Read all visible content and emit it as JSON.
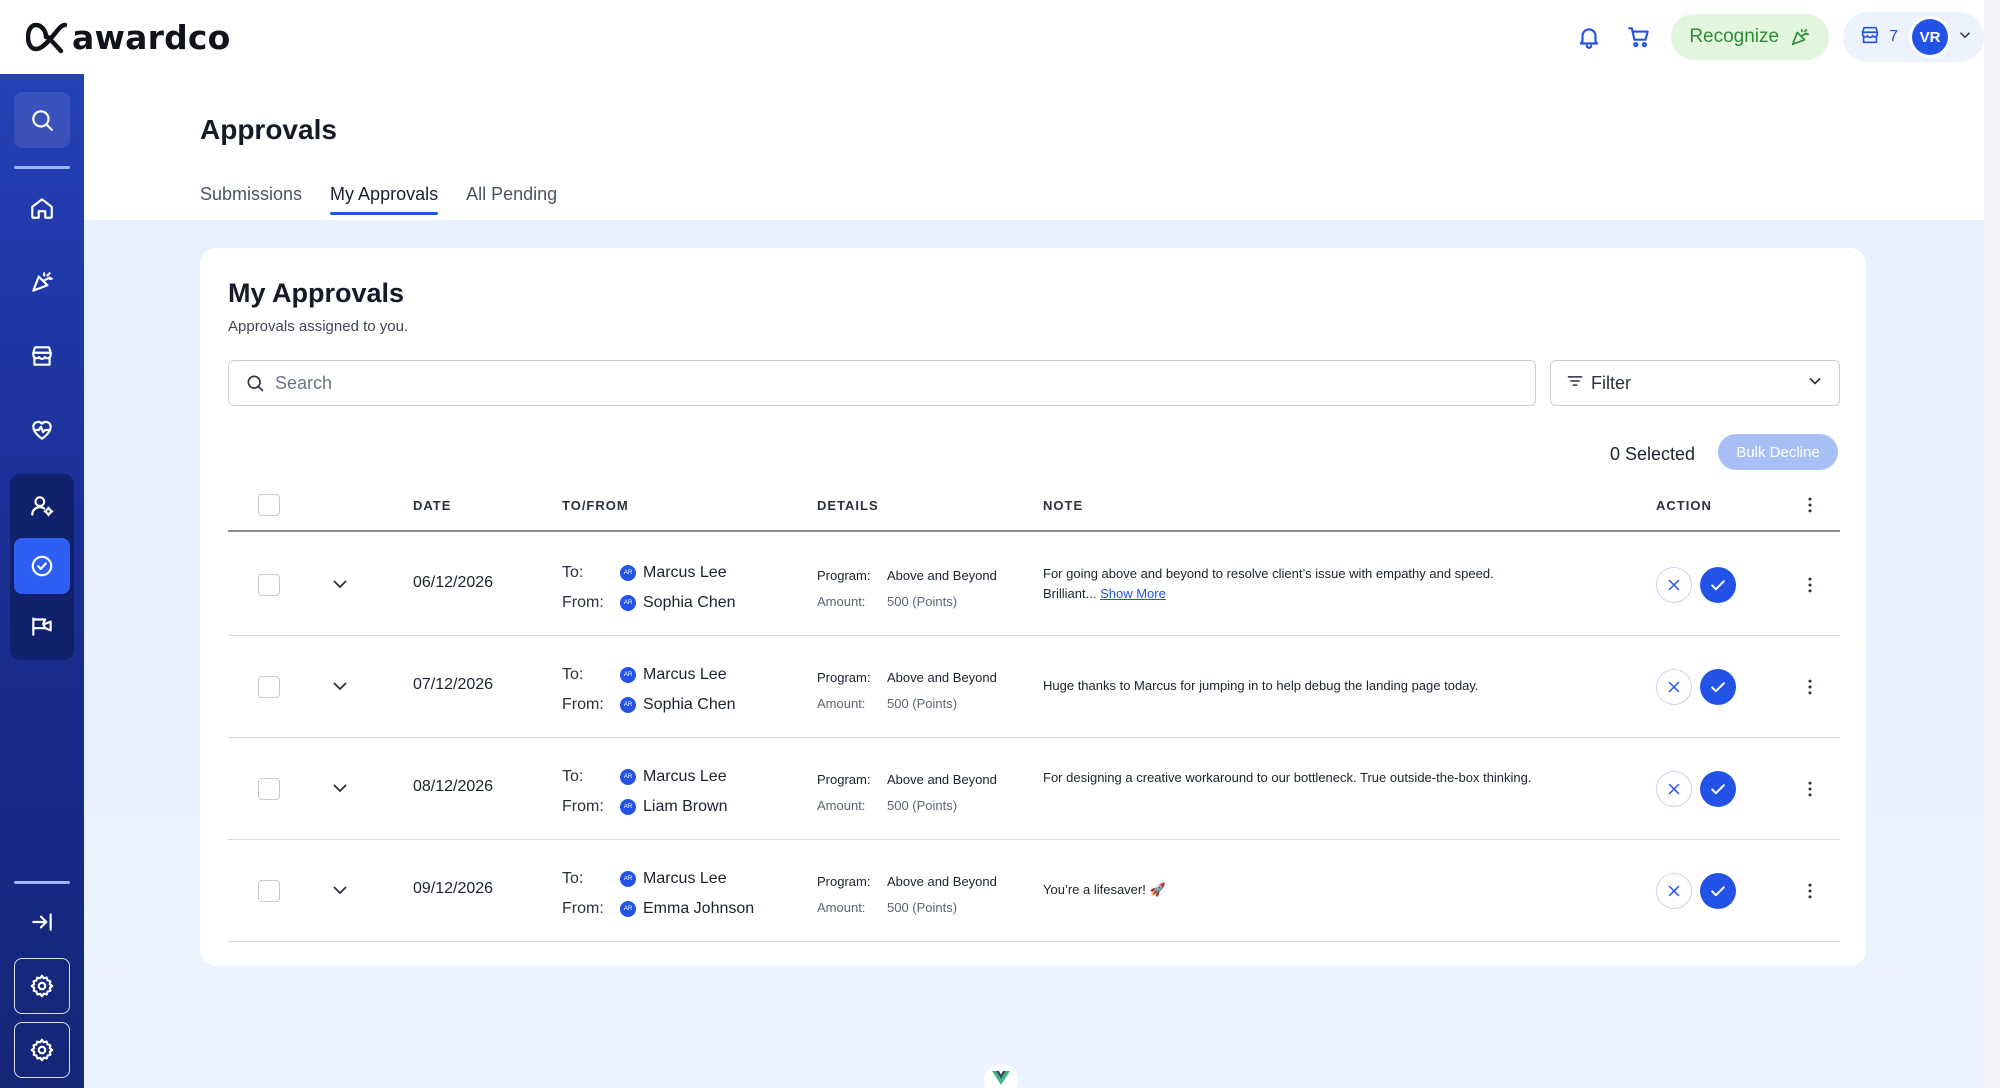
{
  "brand": {
    "name": "awardco"
  },
  "topbar": {
    "recognize_label": "Recognize",
    "store_count": "7",
    "avatar_initials": "VR",
    "icons": [
      "bell-icon",
      "cart-icon",
      "confetti-icon",
      "store-icon",
      "chevron-down-icon"
    ]
  },
  "sidebar": {
    "items": [
      {
        "id": "search",
        "icon": "search-icon"
      },
      {
        "id": "home",
        "icon": "home-icon"
      },
      {
        "id": "recognize",
        "icon": "confetti-icon"
      },
      {
        "id": "store",
        "icon": "store-icon"
      },
      {
        "id": "wellness",
        "icon": "heart-pulse-icon"
      },
      {
        "id": "people",
        "icon": "user-settings-icon"
      },
      {
        "id": "approvals",
        "icon": "check-circle-icon",
        "active": true
      },
      {
        "id": "announcements",
        "icon": "megaphone-icon"
      },
      {
        "id": "collapse",
        "icon": "collapse-icon"
      },
      {
        "id": "settings-1",
        "icon": "gear-icon"
      },
      {
        "id": "settings-2",
        "icon": "gear-icon"
      }
    ]
  },
  "page": {
    "title": "Approvals",
    "tabs": [
      {
        "label": "Submissions",
        "active": false
      },
      {
        "label": "My Approvals",
        "active": true
      },
      {
        "label": "All Pending",
        "active": false
      }
    ]
  },
  "card": {
    "title": "My Approvals",
    "subtitle": "Approvals assigned to you.",
    "search_placeholder": "Search",
    "filter_label": "Filter",
    "selected_count": "0 Selected",
    "bulk_decline_label": "Bulk Decline"
  },
  "table": {
    "headers": {
      "date": "DATE",
      "to_from": "TO/FROM",
      "details": "DETAILS",
      "note": "NOTE",
      "action": "ACTION"
    },
    "labels": {
      "to": "To:",
      "from": "From:",
      "program": "Program:",
      "amount": "Amount:",
      "avatar": "AR"
    },
    "rows": [
      {
        "date": "06/12/2026",
        "to": "Marcus Lee",
        "from": "Sophia Chen",
        "program": "Above and Beyond",
        "amount": "500 (Points)",
        "note": "For going above and beyond to resolve client’s issue with empathy and speed. Brilliant...",
        "show_more": "Show More"
      },
      {
        "date": "07/12/2026",
        "to": "Marcus Lee",
        "from": "Sophia Chen",
        "program": "Above and Beyond",
        "amount": "500 (Points)",
        "note": "Huge thanks to Marcus for jumping in to help debug the landing page today.",
        "show_more": ""
      },
      {
        "date": "08/12/2026",
        "to": "Marcus Lee",
        "from": "Liam Brown",
        "program": "Above and Beyond",
        "amount": "500 (Points)",
        "note": "For designing a creative workaround to our bottleneck. True outside-the-box thinking.",
        "show_more": ""
      },
      {
        "date": "09/12/2026",
        "to": "Marcus Lee",
        "from": "Emma Johnson",
        "program": "Above and Beyond",
        "amount": "500 (Points)",
        "note": "You’re a lifesaver! 🚀",
        "show_more": ""
      }
    ]
  },
  "colors": {
    "primary": "#2353e6",
    "sidebar": "#1a2f96",
    "recognize_bg": "#e1f6dd",
    "recognize_text": "#2f8a36",
    "content_bg": "#e6f0ff",
    "bulk_disabled": "#a8bff5"
  }
}
